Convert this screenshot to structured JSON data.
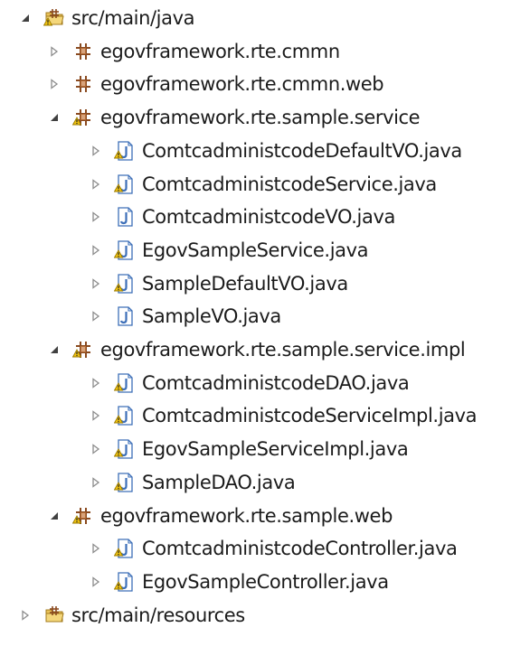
{
  "tree": [
    {
      "label": "src/main/java",
      "kind": "source-folder",
      "state": "expanded",
      "problem": true,
      "depth": 0
    },
    {
      "label": "egovframework.rte.cmmn",
      "kind": "package",
      "state": "collapsed",
      "problem": false,
      "depth": 1
    },
    {
      "label": "egovframework.rte.cmmn.web",
      "kind": "package",
      "state": "collapsed",
      "problem": false,
      "depth": 1
    },
    {
      "label": "egovframework.rte.sample.service",
      "kind": "package",
      "state": "expanded",
      "problem": true,
      "depth": 1
    },
    {
      "label": "ComtcadministcodeDefaultVO.java",
      "kind": "java-file",
      "state": "collapsed",
      "problem": true,
      "depth": 2
    },
    {
      "label": "ComtcadministcodeService.java",
      "kind": "java-file",
      "state": "collapsed",
      "problem": true,
      "depth": 2
    },
    {
      "label": "ComtcadministcodeVO.java",
      "kind": "java-file",
      "state": "collapsed",
      "problem": false,
      "depth": 2
    },
    {
      "label": "EgovSampleService.java",
      "kind": "java-file",
      "state": "collapsed",
      "problem": true,
      "depth": 2
    },
    {
      "label": "SampleDefaultVO.java",
      "kind": "java-file",
      "state": "collapsed",
      "problem": true,
      "depth": 2
    },
    {
      "label": "SampleVO.java",
      "kind": "java-file",
      "state": "collapsed",
      "problem": false,
      "depth": 2
    },
    {
      "label": "egovframework.rte.sample.service.impl",
      "kind": "package",
      "state": "expanded",
      "problem": true,
      "depth": 1
    },
    {
      "label": "ComtcadministcodeDAO.java",
      "kind": "java-file",
      "state": "collapsed",
      "problem": true,
      "depth": 2
    },
    {
      "label": "ComtcadministcodeServiceImpl.java",
      "kind": "java-file",
      "state": "collapsed",
      "problem": true,
      "depth": 2
    },
    {
      "label": "EgovSampleServiceImpl.java",
      "kind": "java-file",
      "state": "collapsed",
      "problem": true,
      "depth": 2
    },
    {
      "label": "SampleDAO.java",
      "kind": "java-file",
      "state": "collapsed",
      "problem": true,
      "depth": 2
    },
    {
      "label": "egovframework.rte.sample.web",
      "kind": "package",
      "state": "expanded",
      "problem": true,
      "depth": 1
    },
    {
      "label": "ComtcadministcodeController.java",
      "kind": "java-file",
      "state": "collapsed",
      "problem": true,
      "depth": 2
    },
    {
      "label": "EgovSampleController.java",
      "kind": "java-file",
      "state": "collapsed",
      "problem": true,
      "depth": 2
    },
    {
      "label": "src/main/resources",
      "kind": "source-folder",
      "state": "collapsed",
      "problem": false,
      "depth": 0
    }
  ],
  "colors": {
    "package_brown": "#8a4a1f",
    "java_file_blue": "#3d6fb8",
    "folder_yellow": "#e9c35a",
    "warning_yellow": "#f1c40f",
    "toggle_grey": "#8c8c8c"
  }
}
